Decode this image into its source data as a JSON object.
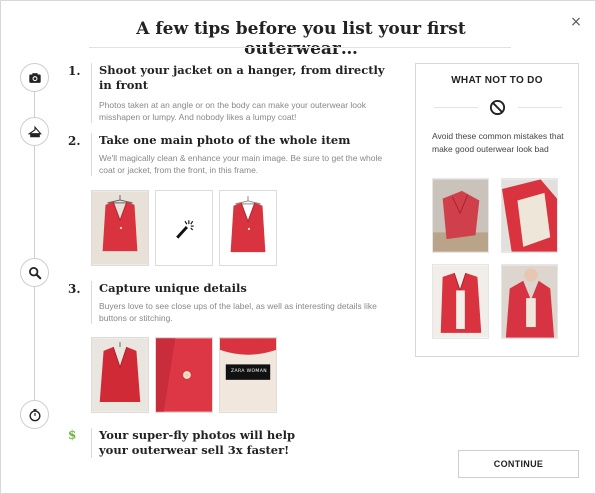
{
  "header": {
    "title": "A few tips before you list your first outerwear…",
    "close_label": "×"
  },
  "timeline": {
    "icons": [
      "camera-icon",
      "hanger-icon",
      "magnifier-icon",
      "stopwatch-icon"
    ]
  },
  "steps": [
    {
      "number": "1.",
      "title": "Shoot your jacket on a hanger, from directly in front",
      "description": "Photos taken at an angle or on the body can make your outerwear look misshapen or lumpy. And nobody likes a lumpy coat!"
    },
    {
      "number": "2.",
      "title": "Take one main photo of the whole item",
      "description": "We'll magically clean & enhance your main image. Be sure to get the whole coat or jacket, from the front, in this frame."
    },
    {
      "number": "3.",
      "title": "Capture unique details",
      "description": "Buyers love to see close ups of the label, as well as interesting details like buttons or stitching."
    }
  ],
  "summary": {
    "symbol": "$",
    "text": "Your super-fly photos will help your outerwear sell 3x faster!"
  },
  "label_photo": {
    "brand": "ZARA WOMAN"
  },
  "what_not_to_do": {
    "title": "WHAT NOT TO DO",
    "description": "Avoid these common mistakes that make good outerwear look bad"
  },
  "footer": {
    "continue_label": "CONTINUE"
  },
  "colors": {
    "jacket_red": "#d8333f",
    "accent_green": "#6cb33f",
    "border_gray": "#d8d8d8"
  }
}
